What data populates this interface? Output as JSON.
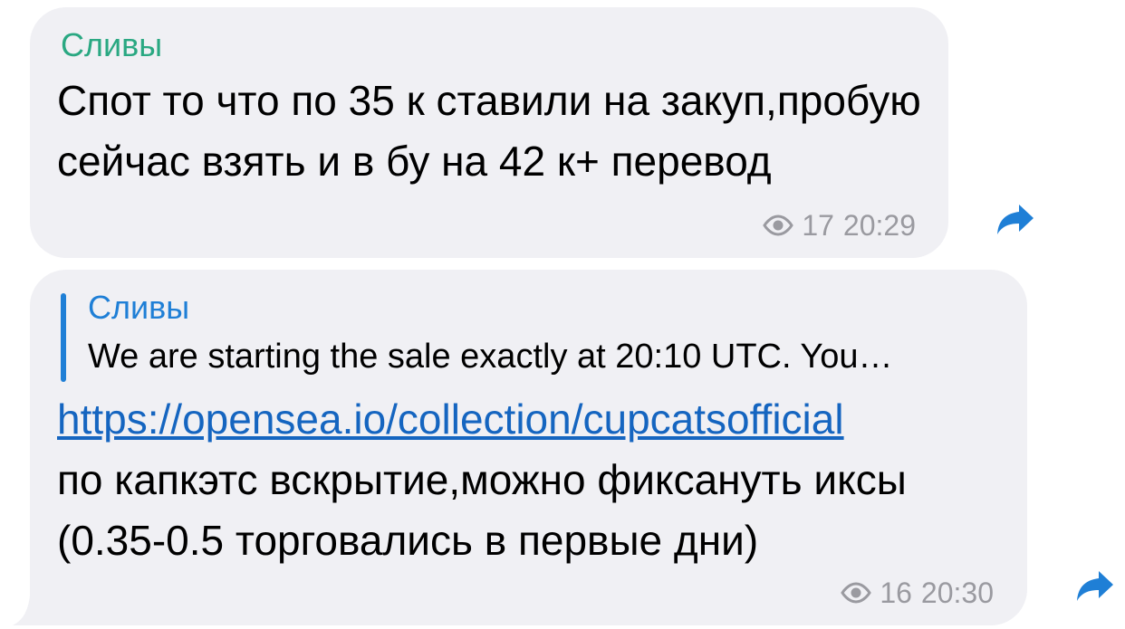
{
  "messages": [
    {
      "sender": "Сливы",
      "text": "Спот то что по 35 к ставили на закуп,пробую сейчас взять и в бу на 42 к+ перевод",
      "views": "17",
      "time": "20:29",
      "icons": [
        "eye-icon",
        "forward-icon"
      ]
    },
    {
      "reply": {
        "sender": "Сливы",
        "text": "We are starting the sale exactly at 20:10 UTC. You…"
      },
      "link": "https://opensea.io/collection/cupcatsofficial",
      "text": "по капкэтс вскрытие,можно фиксануть иксы (0.35-0.5 торговались в первые дни)",
      "views": "16",
      "time": "20:30",
      "icons": [
        "eye-icon",
        "forward-icon"
      ]
    }
  ],
  "colors": {
    "bubble": "#f0f0f4",
    "sender": "#2aa882",
    "reply_accent": "#1f7fd6",
    "link": "#1565c0",
    "meta": "#9a9aa0",
    "forward": "#1f7fd6"
  }
}
